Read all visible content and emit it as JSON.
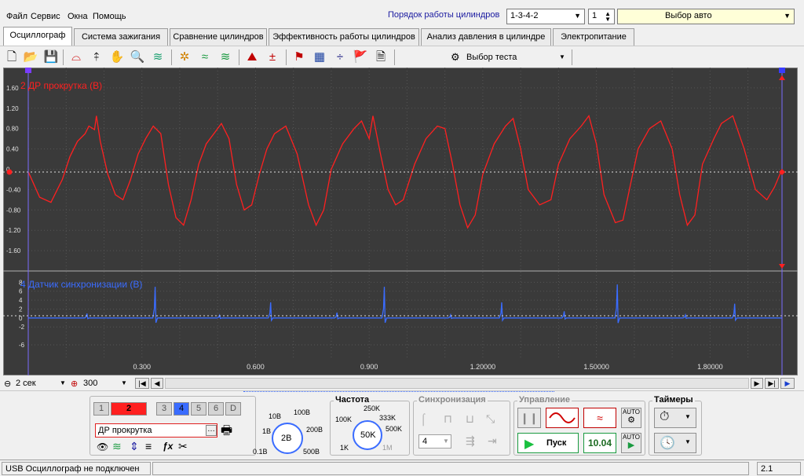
{
  "menu": {
    "items": [
      "Файл",
      "Сервис",
      "Окна",
      "Помощь"
    ]
  },
  "header": {
    "cyl_order_label": "Порядок работы цилиндров",
    "cyl_order_value": "1-3-4-2",
    "cyl_number": "1",
    "vehicle_select": "Выбор авто"
  },
  "tabs": [
    "Осциллограф",
    "Система зажигания",
    "Сравнение цилиндров",
    "Эффективность работы цилиндров",
    "Анализ давления в цилиндре",
    "Электропитание"
  ],
  "toolbar": {
    "test_select": "Выбор теста"
  },
  "colors": {
    "ch1": "#ff2020",
    "ch2": "#3a6cff",
    "bg": "#3a3a3a",
    "grid": "#555555",
    "cursor": "#7a6cff"
  },
  "chart_data": [
    {
      "type": "line",
      "title": "2 ДР прокрутка (В)",
      "ylabel": "",
      "yticks": [
        "1.60",
        "1.20",
        "0.80",
        "0.40",
        "0",
        "-0.40",
        "-0.80",
        "-1.20",
        "-1.60"
      ],
      "ylim": [
        -2.0,
        2.0
      ],
      "xlim": [
        0,
        1.99
      ],
      "grid": true,
      "series": [
        {
          "name": "2 ДР прокрутка (В)",
          "color": "#ff2020",
          "x": [
            0.0,
            0.03,
            0.06,
            0.09,
            0.11,
            0.13,
            0.15,
            0.16,
            0.175,
            0.18,
            0.19,
            0.21,
            0.23,
            0.25,
            0.27,
            0.29,
            0.31,
            0.33,
            0.35,
            0.37,
            0.39,
            0.41,
            0.43,
            0.45,
            0.47,
            0.49,
            0.51,
            0.53,
            0.55,
            0.57,
            0.59,
            0.61,
            0.63,
            0.65,
            0.68,
            0.71,
            0.74,
            0.76,
            0.78,
            0.8,
            0.83,
            0.86,
            0.88,
            0.9,
            0.91,
            0.93,
            0.95,
            0.97,
            0.99,
            1.02,
            1.05,
            1.08,
            1.1,
            1.12,
            1.14,
            1.16,
            1.18,
            1.2,
            1.23,
            1.26,
            1.28,
            1.3,
            1.32,
            1.35,
            1.38,
            1.4,
            1.43,
            1.46,
            1.48,
            1.5,
            1.52,
            1.55,
            1.57,
            1.59,
            1.61,
            1.64,
            1.67,
            1.7,
            1.72,
            1.74,
            1.76,
            1.78,
            1.81,
            1.83,
            1.86,
            1.89,
            1.92,
            1.95,
            1.97,
            1.99
          ],
          "y": [
            -0.05,
            -0.55,
            -0.65,
            -0.2,
            0.25,
            0.55,
            0.7,
            0.85,
            0.78,
            1.05,
            0.55,
            -0.1,
            -0.5,
            -0.6,
            -0.2,
            0.3,
            0.6,
            0.85,
            0.7,
            -0.3,
            -0.95,
            -1.1,
            -0.6,
            0.1,
            0.5,
            0.7,
            0.9,
            0.6,
            -0.3,
            -0.8,
            -0.7,
            -0.1,
            0.4,
            0.7,
            0.85,
            0.3,
            -0.7,
            -1.1,
            -0.8,
            0.0,
            0.5,
            0.8,
            0.95,
            0.6,
            1.05,
            0.3,
            -0.4,
            -0.7,
            -0.6,
            0.1,
            0.6,
            0.85,
            0.8,
            0.1,
            -0.7,
            -1.15,
            -0.9,
            -0.1,
            0.5,
            0.85,
            1.0,
            0.4,
            -0.4,
            -0.7,
            -0.6,
            0.1,
            0.6,
            0.85,
            1.05,
            0.5,
            -0.5,
            -1.05,
            -1.0,
            -0.3,
            0.4,
            0.8,
            0.95,
            0.4,
            -0.5,
            -1.1,
            -0.9,
            0.1,
            0.6,
            0.9,
            1.05,
            0.4,
            -0.4,
            -0.6,
            -0.35,
            0.0
          ]
        }
      ]
    },
    {
      "type": "line",
      "title": "4 Датчик синхронизации (В)",
      "ylabel": "",
      "yticks": [
        "8",
        "6",
        "4",
        "2",
        "0",
        "-2",
        "-6"
      ],
      "ylim": [
        -9,
        10
      ],
      "xlim": [
        0,
        1.99
      ],
      "xticks": [
        "0.300",
        "0.600",
        "0.900",
        "1.20000",
        "1.50000",
        "1.80000"
      ],
      "xtick_values": [
        0.3,
        0.6,
        0.9,
        1.2,
        1.5,
        1.8
      ],
      "grid": true,
      "series": [
        {
          "name": "4 Датчик синхронизации (В)",
          "color": "#3a6cff",
          "spikes": [
            {
              "x": 0.155,
              "y": 1.0
            },
            {
              "x": 0.335,
              "y": 7.0
            },
            {
              "x": 0.505,
              "y": 0.6
            },
            {
              "x": 0.64,
              "y": 3.5
            },
            {
              "x": 0.815,
              "y": 1.2
            },
            {
              "x": 0.94,
              "y": 7.0
            },
            {
              "x": 1.115,
              "y": 0.7
            },
            {
              "x": 1.25,
              "y": 3.5
            },
            {
              "x": 1.415,
              "y": 1.5
            },
            {
              "x": 1.555,
              "y": 7.5
            },
            {
              "x": 1.735,
              "y": 0.7
            },
            {
              "x": 1.865,
              "y": 3.2
            }
          ]
        }
      ]
    }
  ],
  "scale": {
    "time_div": "2 сек",
    "points": "300"
  },
  "panel": {
    "channels": [
      "1",
      "2",
      "3",
      "4",
      "5",
      "6",
      "D"
    ],
    "channel_name": "ДР прокрутка",
    "volt_labels": {
      "v10": "10В",
      "v100": "100В",
      "v1": "1В",
      "v2": "2В",
      "v200": "200В",
      "v01": "0.1В",
      "v500": "500В"
    },
    "freq_label": "Частота",
    "freq_labels": {
      "f100k": "100K",
      "f250k": "250K",
      "f333k": "333K",
      "f500k": "500K",
      "f50k": "50K",
      "f1k": "1K",
      "f1m": "1M"
    },
    "sync_label": "Синхронизация",
    "sync_channel": "4",
    "control_label": "Управление",
    "start_label": "Пуск",
    "sample_value": "10.04",
    "timers_label": "Таймеры",
    "auto_label": "AUTO"
  },
  "status": {
    "text": "USB Осциллограф не подключен",
    "version": "2.1"
  }
}
